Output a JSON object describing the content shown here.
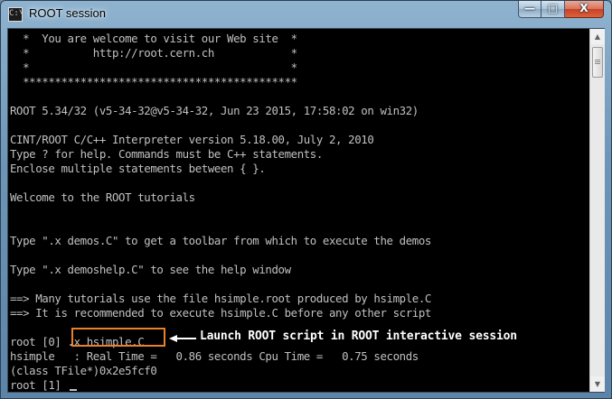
{
  "window": {
    "title": "ROOT session",
    "icon_label": "C:\\"
  },
  "controls": {
    "minimize": "—",
    "maximize": "□",
    "close": "X"
  },
  "console": {
    "lines": [
      "  *  You are welcome to visit our Web site  *",
      "  *          http://root.cern.ch            *",
      "  *                                         *",
      "  *******************************************",
      "",
      "ROOT 5.34/32 (v5-34-32@v5-34-32, Jun 23 2015, 17:58:02 on win32)",
      "",
      "CINT/ROOT C/C++ Interpreter version 5.18.00, July 2, 2010",
      "Type ? for help. Commands must be C++ statements.",
      "Enclose multiple statements between { }.",
      "",
      "Welcome to the ROOT tutorials",
      "",
      "",
      "Type \".x demos.C\" to get a toolbar from which to execute the demos",
      "",
      "Type \".x demoshelp.C\" to see the help window",
      "",
      "==> Many tutorials use the file hsimple.root produced by hsimple.C",
      "==> It is recommended to execute hsimple.C before any other script",
      "",
      "root [0] .x hsimple.C",
      "hsimple   : Real Time =   0.86 seconds Cpu Time =   0.75 seconds",
      "(class TFile*)0x2e5fcf0",
      "root [1] "
    ]
  },
  "annotation": {
    "text": "Launch ROOT script in ROOT interactive session"
  },
  "colors": {
    "highlight_box": "#e9802c",
    "console_text": "#c0c0c0",
    "console_bg": "#000000"
  }
}
